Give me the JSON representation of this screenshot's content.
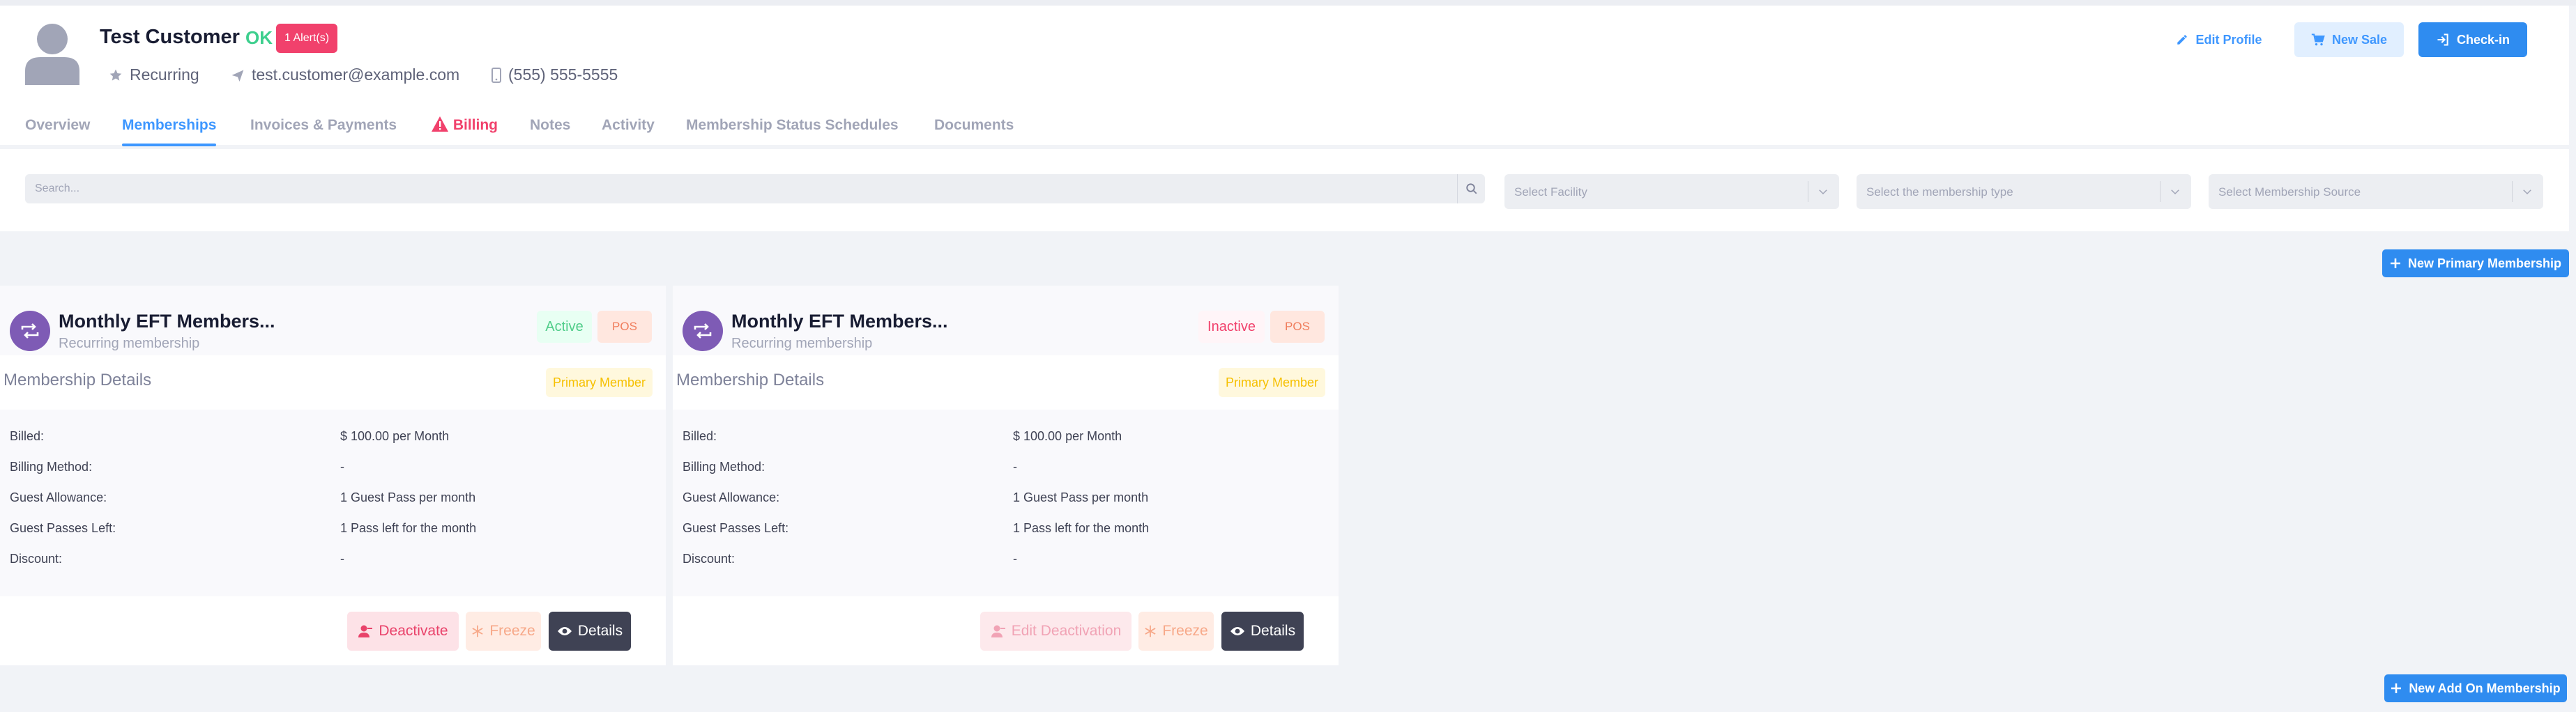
{
  "header": {
    "customer_name": "Test Customer",
    "status": "OK",
    "alert_badge": "1 Alert(s)",
    "plan_type": "Recurring",
    "email": "test.customer@example.com",
    "phone": "(555) 555-5555",
    "edit_profile": "Edit Profile",
    "new_sale": "New Sale",
    "check_in": "Check-in"
  },
  "tabs": [
    "Overview",
    "Memberships",
    "Invoices & Payments",
    "Billing",
    "Notes",
    "Activity",
    "Membership Status Schedules",
    "Documents"
  ],
  "active_tab": "Memberships",
  "filters": {
    "search_placeholder": "Search...",
    "facility_placeholder": "Select Facility",
    "type_placeholder": "Select the membership type",
    "source_placeholder": "Select Membership Source"
  },
  "new_primary_label": "New Primary Membership",
  "new_addon_label": "New Add On Membership",
  "detail_labels": [
    "Billed:",
    "Billing Method:",
    "Guest Allowance:",
    "Guest Passes Left:",
    "Discount:"
  ],
  "memberships": [
    {
      "title": "Monthly EFT Members...",
      "subtitle": "Recurring membership",
      "status": "Active",
      "source": "POS",
      "section_title": "Membership Details",
      "member_role": "Primary Member",
      "values": [
        "$ 100.00 per Month",
        "-",
        "1 Guest Pass per month",
        "1 Pass left for the month",
        "-"
      ],
      "action_primary": "Deactivate",
      "action_freeze": "Freeze",
      "action_details": "Details"
    },
    {
      "title": "Monthly EFT Members...",
      "subtitle": "Recurring membership",
      "status": "Inactive",
      "source": "POS",
      "section_title": "Membership Details",
      "member_role": "Primary Member",
      "values": [
        "$ 100.00 per Month",
        "-",
        "1 Guest Pass per month",
        "1 Pass left for the month",
        "-"
      ],
      "action_primary": "Edit Deactivation",
      "action_freeze": "Freeze",
      "action_details": "Details"
    }
  ]
}
